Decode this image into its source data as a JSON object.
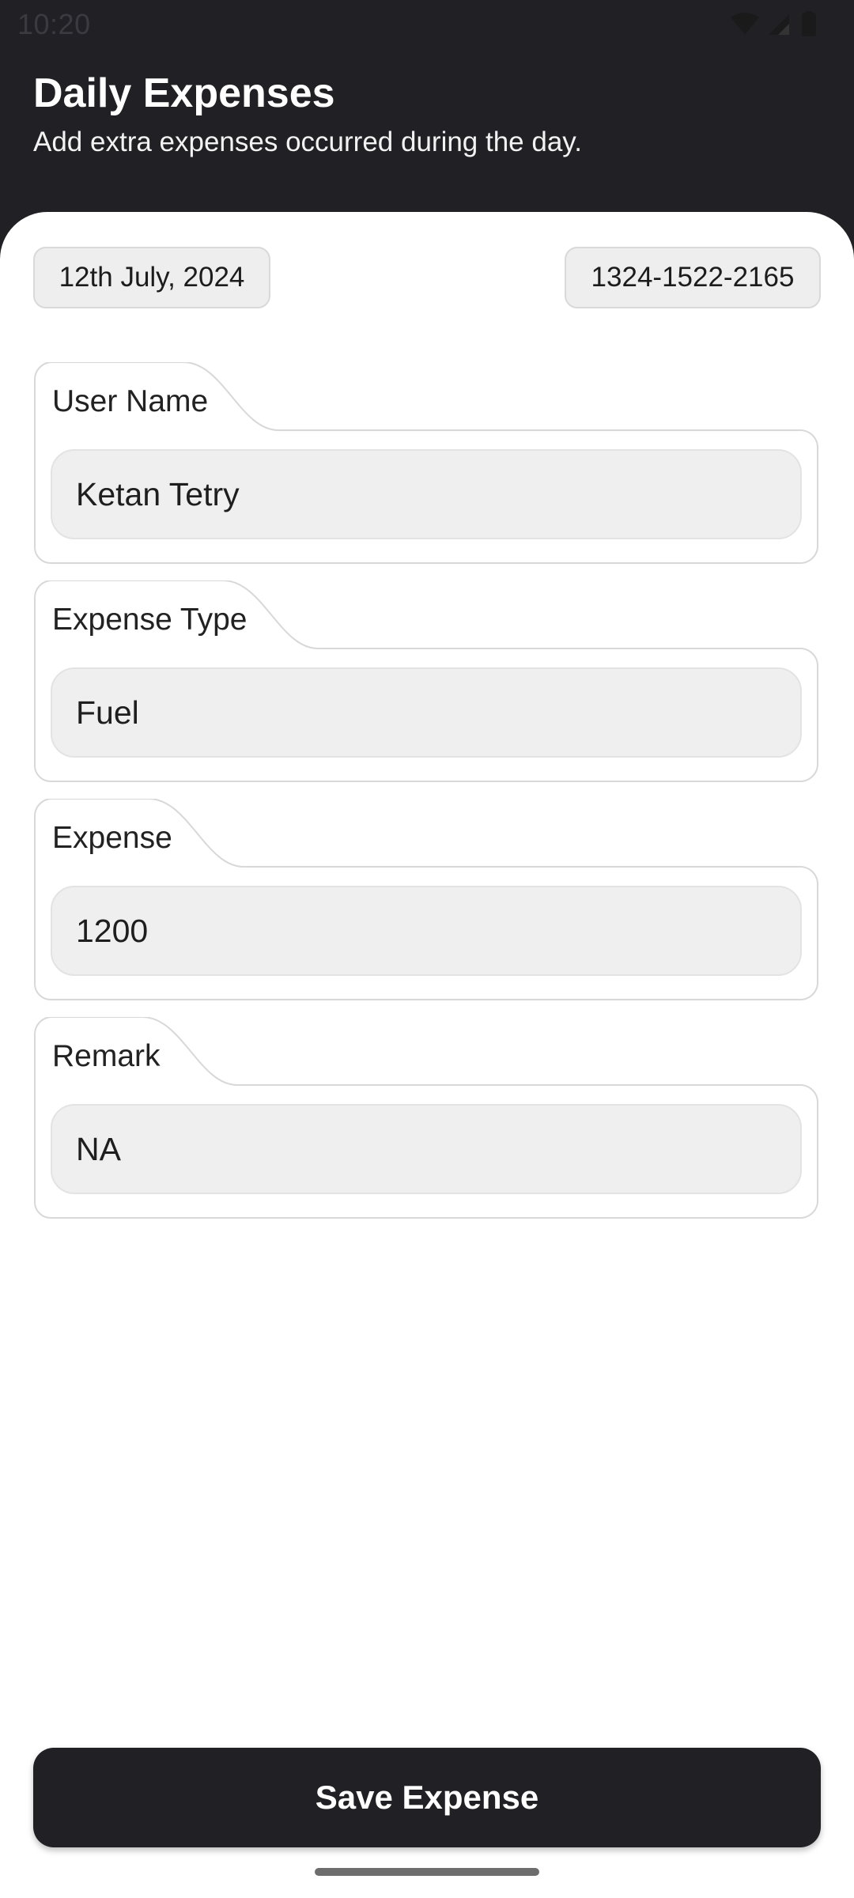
{
  "status_bar": {
    "time": "10:20",
    "icons": [
      "wifi-icon",
      "cellular-signal-icon",
      "battery-icon"
    ]
  },
  "header": {
    "title": "Daily Expenses",
    "subtitle": "Add extra expenses occurred during the day."
  },
  "chips": {
    "date": "12th July, 2024",
    "id": "1324-1522-2165"
  },
  "form": {
    "fields": [
      {
        "label": "User Name",
        "value": "Ketan Tetry"
      },
      {
        "label": "Expense Type",
        "value": "Fuel"
      },
      {
        "label": "Expense",
        "value": "1200"
      },
      {
        "label": "Remark",
        "value": "NA"
      }
    ]
  },
  "actions": {
    "save_label": "Save Expense"
  },
  "colors": {
    "header_background": "#212024",
    "sheet_background": "#ffffff",
    "input_background": "#efefef",
    "button_background": "#212024",
    "button_text": "#ffffff"
  }
}
